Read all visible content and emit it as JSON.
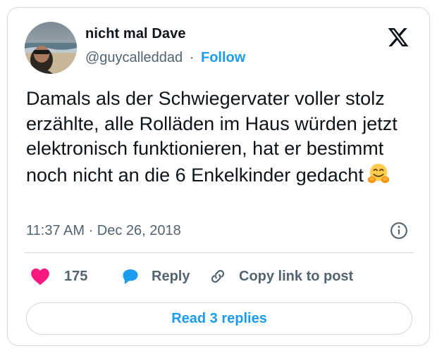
{
  "author": {
    "display_name": "nicht mal Dave",
    "handle": "@guycalleddad",
    "separator": "·",
    "follow_label": "Follow"
  },
  "tweet": {
    "text": "Damals als der Schwiegervater voller stolz erzählte, alle Rolläden im Haus würden jetzt elektronisch funktionieren, hat er bestimmt noch nicht an die 6 Enkelkinder gedacht",
    "emoji": "hugging-face-emoji",
    "timestamp": "11:37 AM · Dec 26, 2018"
  },
  "actions": {
    "like_count": "175",
    "reply_label": "Reply",
    "copy_link_label": "Copy link to post"
  },
  "read_replies_label": "Read 3 replies",
  "colors": {
    "accent": "#1d9bf0",
    "like": "#f91880",
    "text_primary": "#0f1419",
    "text_secondary": "#536471",
    "border": "#cfd9de"
  },
  "icons": [
    "avatar",
    "x-logo-icon",
    "info-icon",
    "heart-icon",
    "reply-bubble-icon",
    "link-icon"
  ]
}
